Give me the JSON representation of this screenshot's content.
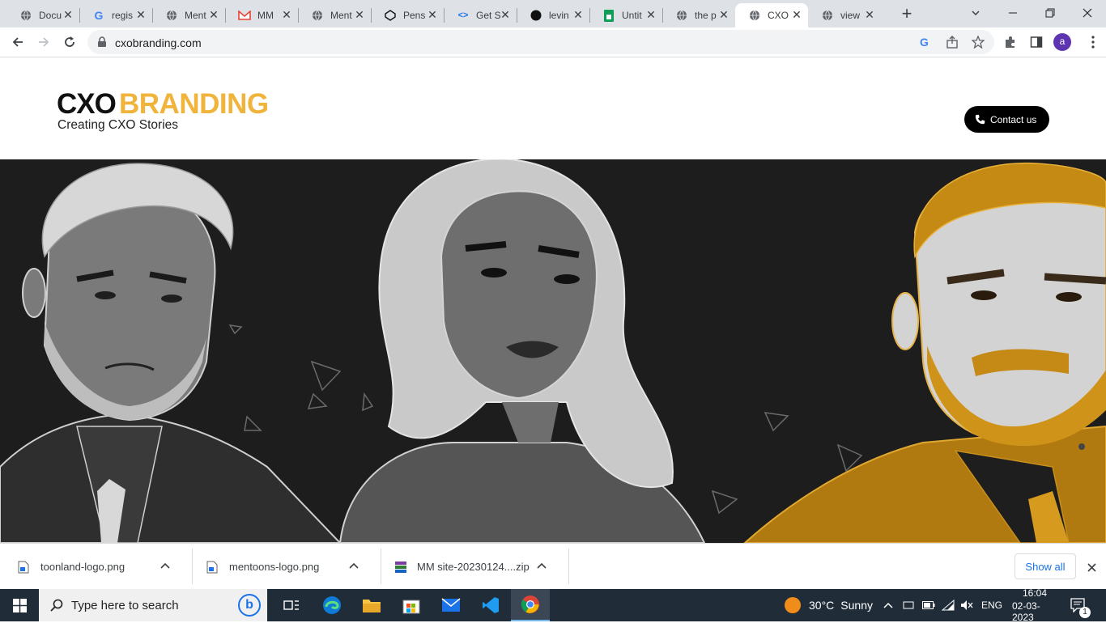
{
  "browser": {
    "tabs": [
      {
        "title": "Docu",
        "icon": "globe-icon"
      },
      {
        "title": "regis",
        "icon": "google-icon"
      },
      {
        "title": "Ment",
        "icon": "globe-icon"
      },
      {
        "title": "MM",
        "icon": "gmail-icon"
      },
      {
        "title": "Ment",
        "icon": "globe-icon"
      },
      {
        "title": "Pens",
        "icon": "codepen-icon"
      },
      {
        "title": "Get S",
        "icon": "code-icon"
      },
      {
        "title": "levin",
        "icon": "github-icon"
      },
      {
        "title": "Untit",
        "icon": "sheets-icon"
      },
      {
        "title": "the p",
        "icon": "globe-icon"
      },
      {
        "title": "CXO",
        "icon": "globe-icon",
        "active": true
      },
      {
        "title": "view",
        "icon": "globe-icon"
      }
    ],
    "new_tab_symbol": "+",
    "url": "cxobranding.com",
    "profile_initial": "a"
  },
  "site": {
    "logo_word_1": "CXO",
    "logo_word_2": "BRANDING",
    "tagline": "Creating CXO Stories",
    "contact_label": "Contact us",
    "accent_color": "#f0b43c"
  },
  "downloads": {
    "items": [
      {
        "name": "toonland-logo.png",
        "icon": "image-file-icon"
      },
      {
        "name": "mentoons-logo.png",
        "icon": "image-file-icon"
      },
      {
        "name": "MM site-20230124....zip",
        "icon": "archive-file-icon"
      }
    ],
    "show_all": "Show all"
  },
  "taskbar": {
    "search_placeholder": "Type here to search",
    "weather_temp": "30°C",
    "weather_text": "Sunny",
    "language": "ENG",
    "time": "16:04",
    "date": "02-03-2023",
    "notification_count": "1"
  }
}
